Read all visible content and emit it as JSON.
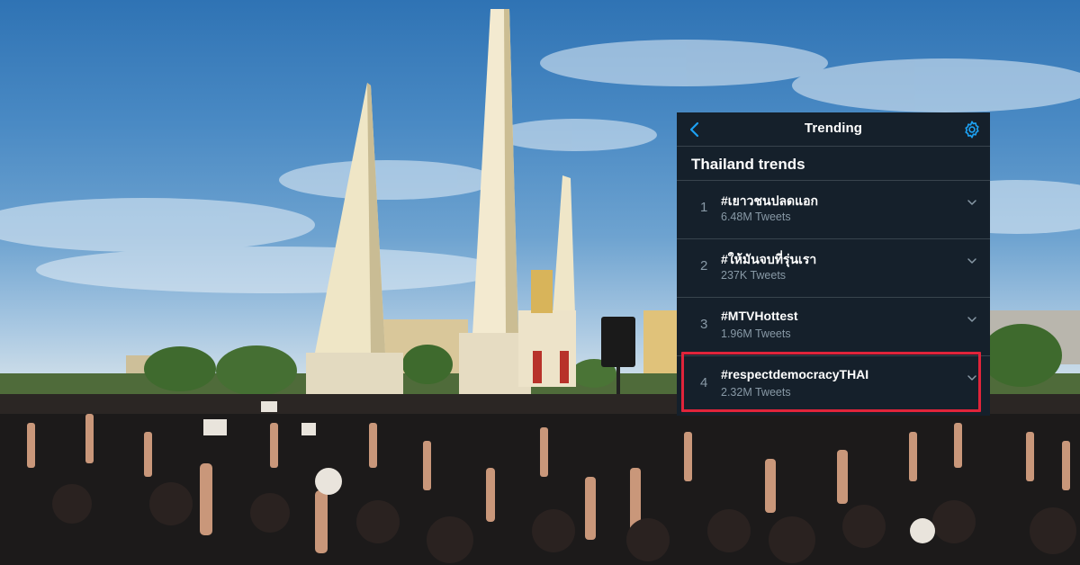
{
  "header": {
    "title": "Trending",
    "back_icon": "chevron-left-icon",
    "settings_icon": "gear-icon"
  },
  "section": {
    "title": "Thailand trends"
  },
  "trends": [
    {
      "rank": "1",
      "name": "#เยาวชนปลดแอก",
      "count": "6.48M Tweets"
    },
    {
      "rank": "2",
      "name": "#ให้มันจบที่รุ่นเรา",
      "count": "237K Tweets"
    },
    {
      "rank": "3",
      "name": "#MTVHottest",
      "count": "1.96M Tweets"
    },
    {
      "rank": "4",
      "name": "#respectdemocracyTHAI",
      "count": "2.32M Tweets"
    }
  ],
  "highlighted_trend": "4",
  "colors": {
    "panel_bg": "#15202b",
    "accent": "#1da1f2",
    "muted_text": "#8899a6",
    "divider": "#38444d",
    "highlight": "#e0243a"
  }
}
